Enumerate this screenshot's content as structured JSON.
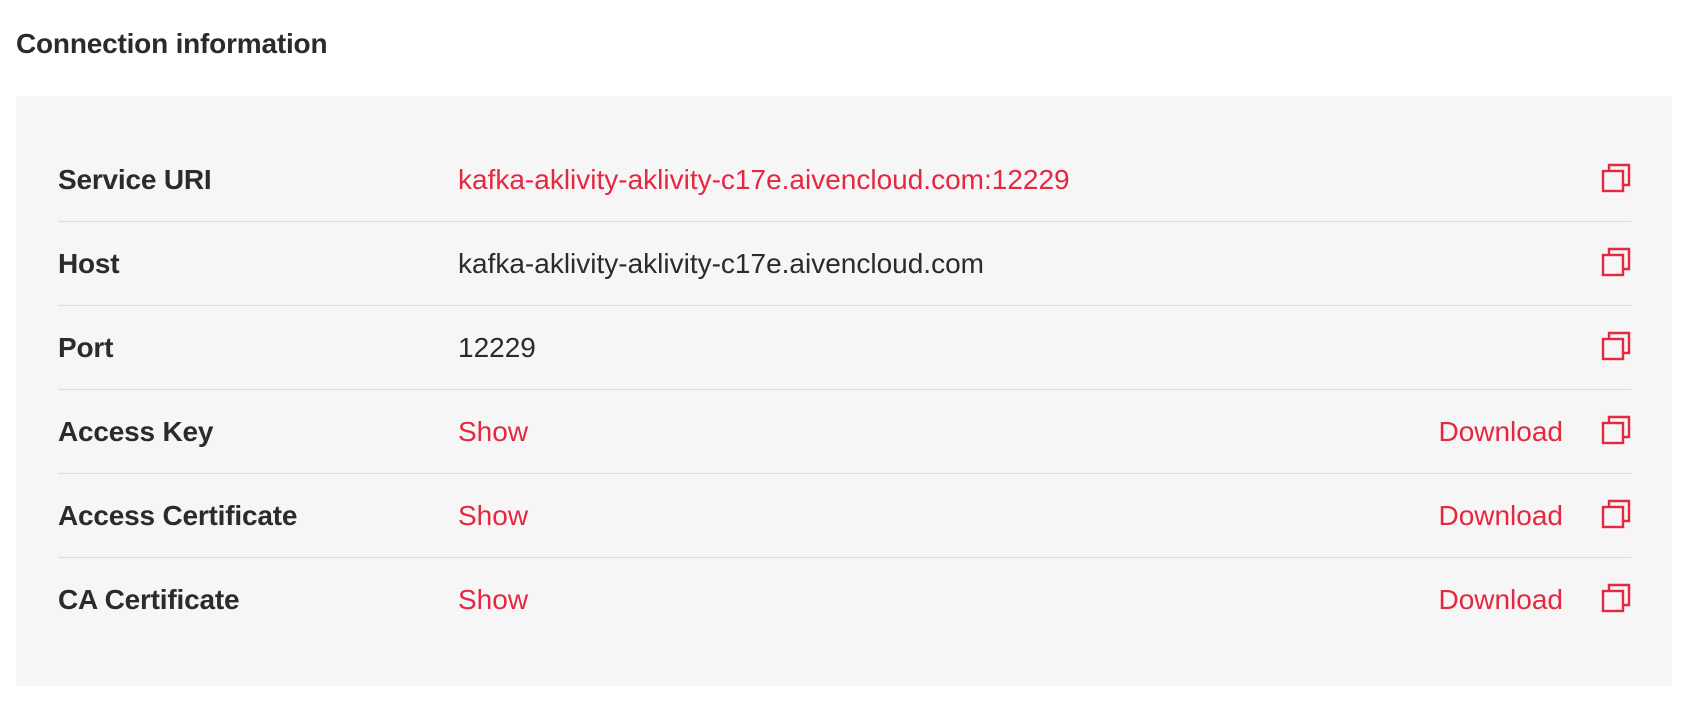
{
  "title": "Connection information",
  "accent_color": "#e5283f",
  "rows": [
    {
      "label": "Service URI",
      "value": "kafka-aklivity-aklivity-c17e.aivencloud.com:12229"
    },
    {
      "label": "Host",
      "value": "kafka-aklivity-aklivity-c17e.aivencloud.com"
    },
    {
      "label": "Port",
      "value": "12229"
    },
    {
      "label": "Access Key",
      "value": "Show",
      "download": "Download"
    },
    {
      "label": "Access Certificate",
      "value": "Show",
      "download": "Download"
    },
    {
      "label": "CA Certificate",
      "value": "Show",
      "download": "Download"
    }
  ],
  "icons": {
    "copy": "copy-icon"
  }
}
